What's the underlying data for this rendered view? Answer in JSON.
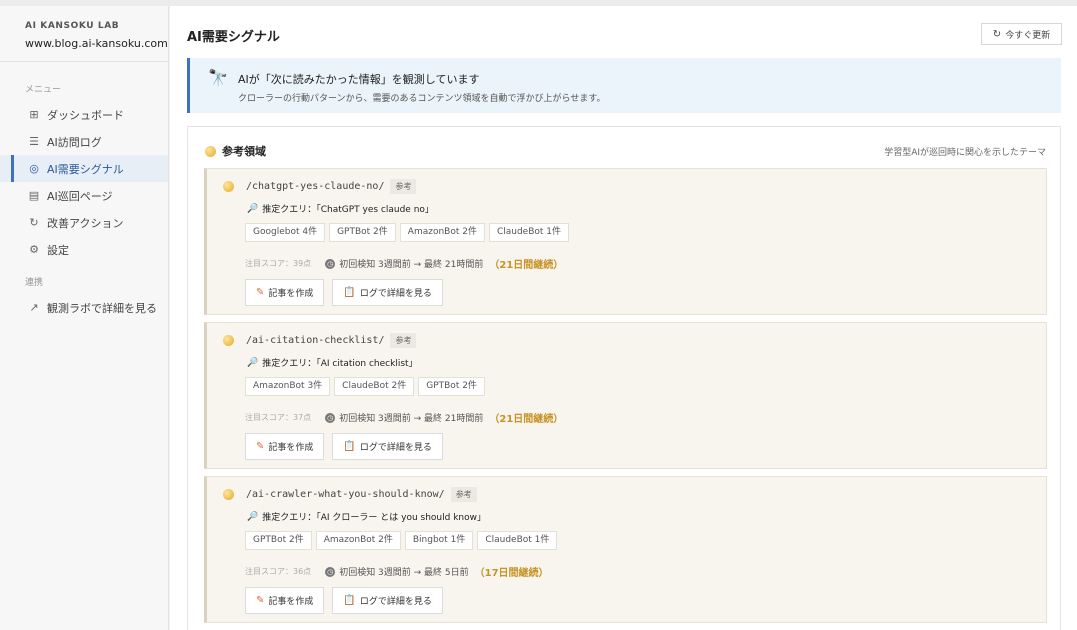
{
  "sidebar": {
    "brand_lab": "AI KANSOKU LAB",
    "brand_domain": "www.blog.ai-kansoku.com",
    "menu_section": "メニュー",
    "items": [
      {
        "label": "ダッシュボード",
        "icon": "grid-icon"
      },
      {
        "label": "AI訪問ログ",
        "icon": "list-icon"
      },
      {
        "label": "AI需要シグナル",
        "icon": "signal-icon",
        "active": true
      },
      {
        "label": "AI巡回ページ",
        "icon": "page-icon"
      },
      {
        "label": "改善アクション",
        "icon": "refresh-icon"
      },
      {
        "label": "設定",
        "icon": "gear-icon"
      }
    ],
    "link_section": "連携",
    "external_link": "観測ラボで詳細を見る"
  },
  "header": {
    "title": "AI需要シグナル",
    "refresh_label": "今すぐ更新"
  },
  "banner": {
    "title": "AIが「次に読みたかった情報」を観測しています",
    "subtitle": "クローラーの行動パターンから、需要のあるコンテンツ領域を自動で浮かび上がらせます。"
  },
  "panel": {
    "title": "参考領域",
    "note": "学習型AIが巡回時に関心を示したテーマ",
    "cards": [
      {
        "path": "/chatgpt-yes-claude-no/",
        "badge": "参考",
        "query": "推定クエリ：「ChatGPT yes claude no」",
        "tags": [
          "Googlebot 4件",
          "GPTBot 2件",
          "AmazonBot 2件",
          "ClaudeBot 1件"
        ],
        "score": "注目スコア：39点",
        "detect": "初回検知 3週間前 → 最終 21時間前",
        "continuation": "（21日間継続）",
        "create_label": "記事を作成",
        "log_label": "ログで詳細を見る"
      },
      {
        "path": "/ai-citation-checklist/",
        "badge": "参考",
        "query": "推定クエリ：「AI citation checklist」",
        "tags": [
          "AmazonBot 3件",
          "ClaudeBot 2件",
          "GPTBot 2件"
        ],
        "score": "注目スコア：37点",
        "detect": "初回検知 3週間前 → 最終 21時間前",
        "continuation": "（21日間継続）",
        "create_label": "記事を作成",
        "log_label": "ログで詳細を見る"
      },
      {
        "path": "/ai-crawler-what-you-should-know/",
        "badge": "参考",
        "query": "推定クエリ：「AI クローラー とは you should know」",
        "tags": [
          "GPTBot 2件",
          "AmazonBot 2件",
          "Bingbot 1件",
          "ClaudeBot 1件"
        ],
        "score": "注目スコア：36点",
        "detect": "初回検知 3週間前 → 最終 5日前",
        "continuation": "（17日間継続）",
        "create_label": "記事を作成",
        "log_label": "ログで詳細を見る"
      }
    ]
  },
  "colors": {
    "accent": "#3b73c2",
    "banner_bg": "#ebf3fb",
    "card_bg": "#f7f5ee",
    "continuation": "#c89224"
  }
}
